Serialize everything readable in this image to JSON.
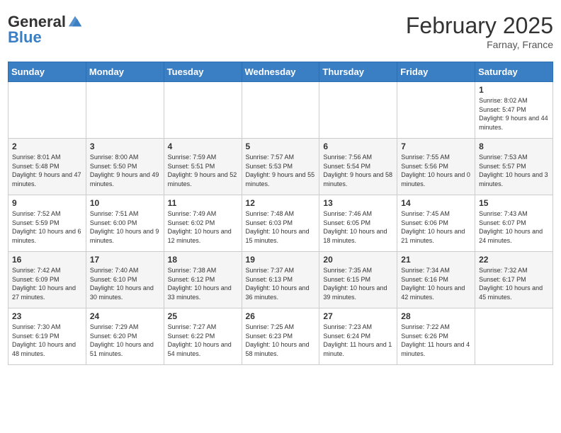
{
  "header": {
    "logo_line1": "General",
    "logo_line2": "Blue",
    "title": "February 2025",
    "subtitle": "Farnay, France"
  },
  "days_of_week": [
    "Sunday",
    "Monday",
    "Tuesday",
    "Wednesday",
    "Thursday",
    "Friday",
    "Saturday"
  ],
  "weeks": [
    [
      {
        "day": "",
        "info": ""
      },
      {
        "day": "",
        "info": ""
      },
      {
        "day": "",
        "info": ""
      },
      {
        "day": "",
        "info": ""
      },
      {
        "day": "",
        "info": ""
      },
      {
        "day": "",
        "info": ""
      },
      {
        "day": "1",
        "info": "Sunrise: 8:02 AM\nSunset: 5:47 PM\nDaylight: 9 hours and 44 minutes."
      }
    ],
    [
      {
        "day": "2",
        "info": "Sunrise: 8:01 AM\nSunset: 5:48 PM\nDaylight: 9 hours and 47 minutes."
      },
      {
        "day": "3",
        "info": "Sunrise: 8:00 AM\nSunset: 5:50 PM\nDaylight: 9 hours and 49 minutes."
      },
      {
        "day": "4",
        "info": "Sunrise: 7:59 AM\nSunset: 5:51 PM\nDaylight: 9 hours and 52 minutes."
      },
      {
        "day": "5",
        "info": "Sunrise: 7:57 AM\nSunset: 5:53 PM\nDaylight: 9 hours and 55 minutes."
      },
      {
        "day": "6",
        "info": "Sunrise: 7:56 AM\nSunset: 5:54 PM\nDaylight: 9 hours and 58 minutes."
      },
      {
        "day": "7",
        "info": "Sunrise: 7:55 AM\nSunset: 5:56 PM\nDaylight: 10 hours and 0 minutes."
      },
      {
        "day": "8",
        "info": "Sunrise: 7:53 AM\nSunset: 5:57 PM\nDaylight: 10 hours and 3 minutes."
      }
    ],
    [
      {
        "day": "9",
        "info": "Sunrise: 7:52 AM\nSunset: 5:59 PM\nDaylight: 10 hours and 6 minutes."
      },
      {
        "day": "10",
        "info": "Sunrise: 7:51 AM\nSunset: 6:00 PM\nDaylight: 10 hours and 9 minutes."
      },
      {
        "day": "11",
        "info": "Sunrise: 7:49 AM\nSunset: 6:02 PM\nDaylight: 10 hours and 12 minutes."
      },
      {
        "day": "12",
        "info": "Sunrise: 7:48 AM\nSunset: 6:03 PM\nDaylight: 10 hours and 15 minutes."
      },
      {
        "day": "13",
        "info": "Sunrise: 7:46 AM\nSunset: 6:05 PM\nDaylight: 10 hours and 18 minutes."
      },
      {
        "day": "14",
        "info": "Sunrise: 7:45 AM\nSunset: 6:06 PM\nDaylight: 10 hours and 21 minutes."
      },
      {
        "day": "15",
        "info": "Sunrise: 7:43 AM\nSunset: 6:07 PM\nDaylight: 10 hours and 24 minutes."
      }
    ],
    [
      {
        "day": "16",
        "info": "Sunrise: 7:42 AM\nSunset: 6:09 PM\nDaylight: 10 hours and 27 minutes."
      },
      {
        "day": "17",
        "info": "Sunrise: 7:40 AM\nSunset: 6:10 PM\nDaylight: 10 hours and 30 minutes."
      },
      {
        "day": "18",
        "info": "Sunrise: 7:38 AM\nSunset: 6:12 PM\nDaylight: 10 hours and 33 minutes."
      },
      {
        "day": "19",
        "info": "Sunrise: 7:37 AM\nSunset: 6:13 PM\nDaylight: 10 hours and 36 minutes."
      },
      {
        "day": "20",
        "info": "Sunrise: 7:35 AM\nSunset: 6:15 PM\nDaylight: 10 hours and 39 minutes."
      },
      {
        "day": "21",
        "info": "Sunrise: 7:34 AM\nSunset: 6:16 PM\nDaylight: 10 hours and 42 minutes."
      },
      {
        "day": "22",
        "info": "Sunrise: 7:32 AM\nSunset: 6:17 PM\nDaylight: 10 hours and 45 minutes."
      }
    ],
    [
      {
        "day": "23",
        "info": "Sunrise: 7:30 AM\nSunset: 6:19 PM\nDaylight: 10 hours and 48 minutes."
      },
      {
        "day": "24",
        "info": "Sunrise: 7:29 AM\nSunset: 6:20 PM\nDaylight: 10 hours and 51 minutes."
      },
      {
        "day": "25",
        "info": "Sunrise: 7:27 AM\nSunset: 6:22 PM\nDaylight: 10 hours and 54 minutes."
      },
      {
        "day": "26",
        "info": "Sunrise: 7:25 AM\nSunset: 6:23 PM\nDaylight: 10 hours and 58 minutes."
      },
      {
        "day": "27",
        "info": "Sunrise: 7:23 AM\nSunset: 6:24 PM\nDaylight: 11 hours and 1 minute."
      },
      {
        "day": "28",
        "info": "Sunrise: 7:22 AM\nSunset: 6:26 PM\nDaylight: 11 hours and 4 minutes."
      },
      {
        "day": "",
        "info": ""
      }
    ]
  ]
}
